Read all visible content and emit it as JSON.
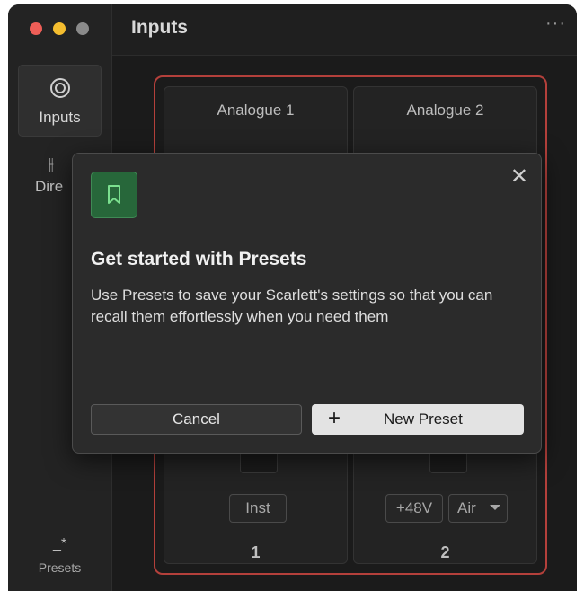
{
  "window": {
    "title": "Inputs",
    "more_label": "···"
  },
  "sidebar": {
    "inputs_label": "Inputs",
    "direct_label": "Dire",
    "presets_icon": "_*",
    "presets_label": "Presets"
  },
  "channels": [
    {
      "name": "Analogue 1",
      "buttons": [
        "Inst"
      ],
      "number": "1"
    },
    {
      "name": "Analogue 2",
      "buttons": [
        "+48V",
        "Air"
      ],
      "number": "2"
    }
  ],
  "dialog": {
    "title": "Get started with Presets",
    "body": "Use Presets to save your Scarlett's settings so that you can recall them effortlessly when you need them",
    "cancel_label": "Cancel",
    "new_preset_label": "New Preset",
    "plus_symbol": "+"
  },
  "colors": {
    "accent_red": "#b4403b",
    "preset_green": "#27673a"
  }
}
